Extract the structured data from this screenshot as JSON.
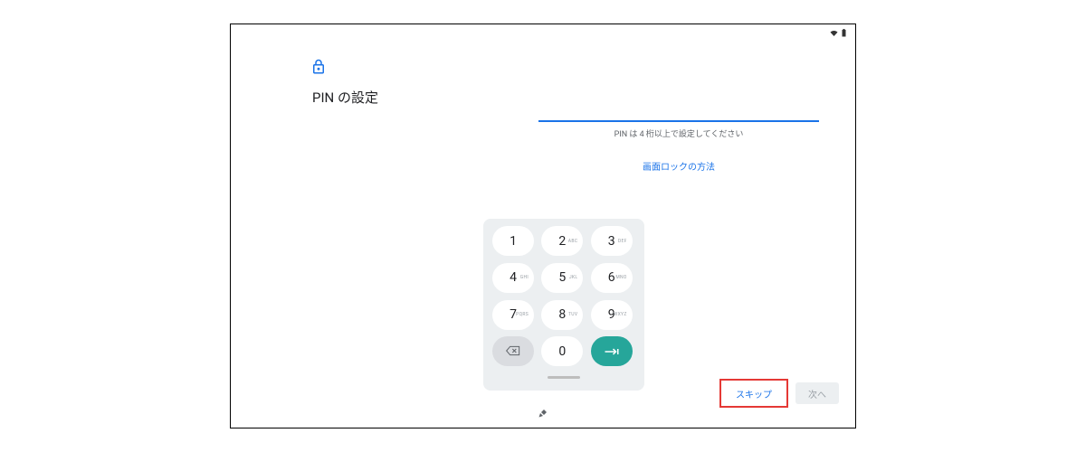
{
  "header": {
    "title": "PIN の設定"
  },
  "pin": {
    "value": "",
    "hint": "PIN は 4 桁以上で設定してください",
    "lock_method_link": "画面ロックの方法"
  },
  "keypad": {
    "keys": [
      {
        "digit": "1",
        "letters": ""
      },
      {
        "digit": "2",
        "letters": "ABC"
      },
      {
        "digit": "3",
        "letters": "DEF"
      },
      {
        "digit": "4",
        "letters": "GHI"
      },
      {
        "digit": "5",
        "letters": "JKL"
      },
      {
        "digit": "6",
        "letters": "MNO"
      },
      {
        "digit": "7",
        "letters": "PQRS"
      },
      {
        "digit": "8",
        "letters": "TUV"
      },
      {
        "digit": "9",
        "letters": "WXYZ"
      },
      {
        "digit": "0",
        "letters": ""
      }
    ]
  },
  "buttons": {
    "skip": "スキップ",
    "next": "次へ"
  },
  "status": {
    "wifi": "connected",
    "battery": "full"
  }
}
